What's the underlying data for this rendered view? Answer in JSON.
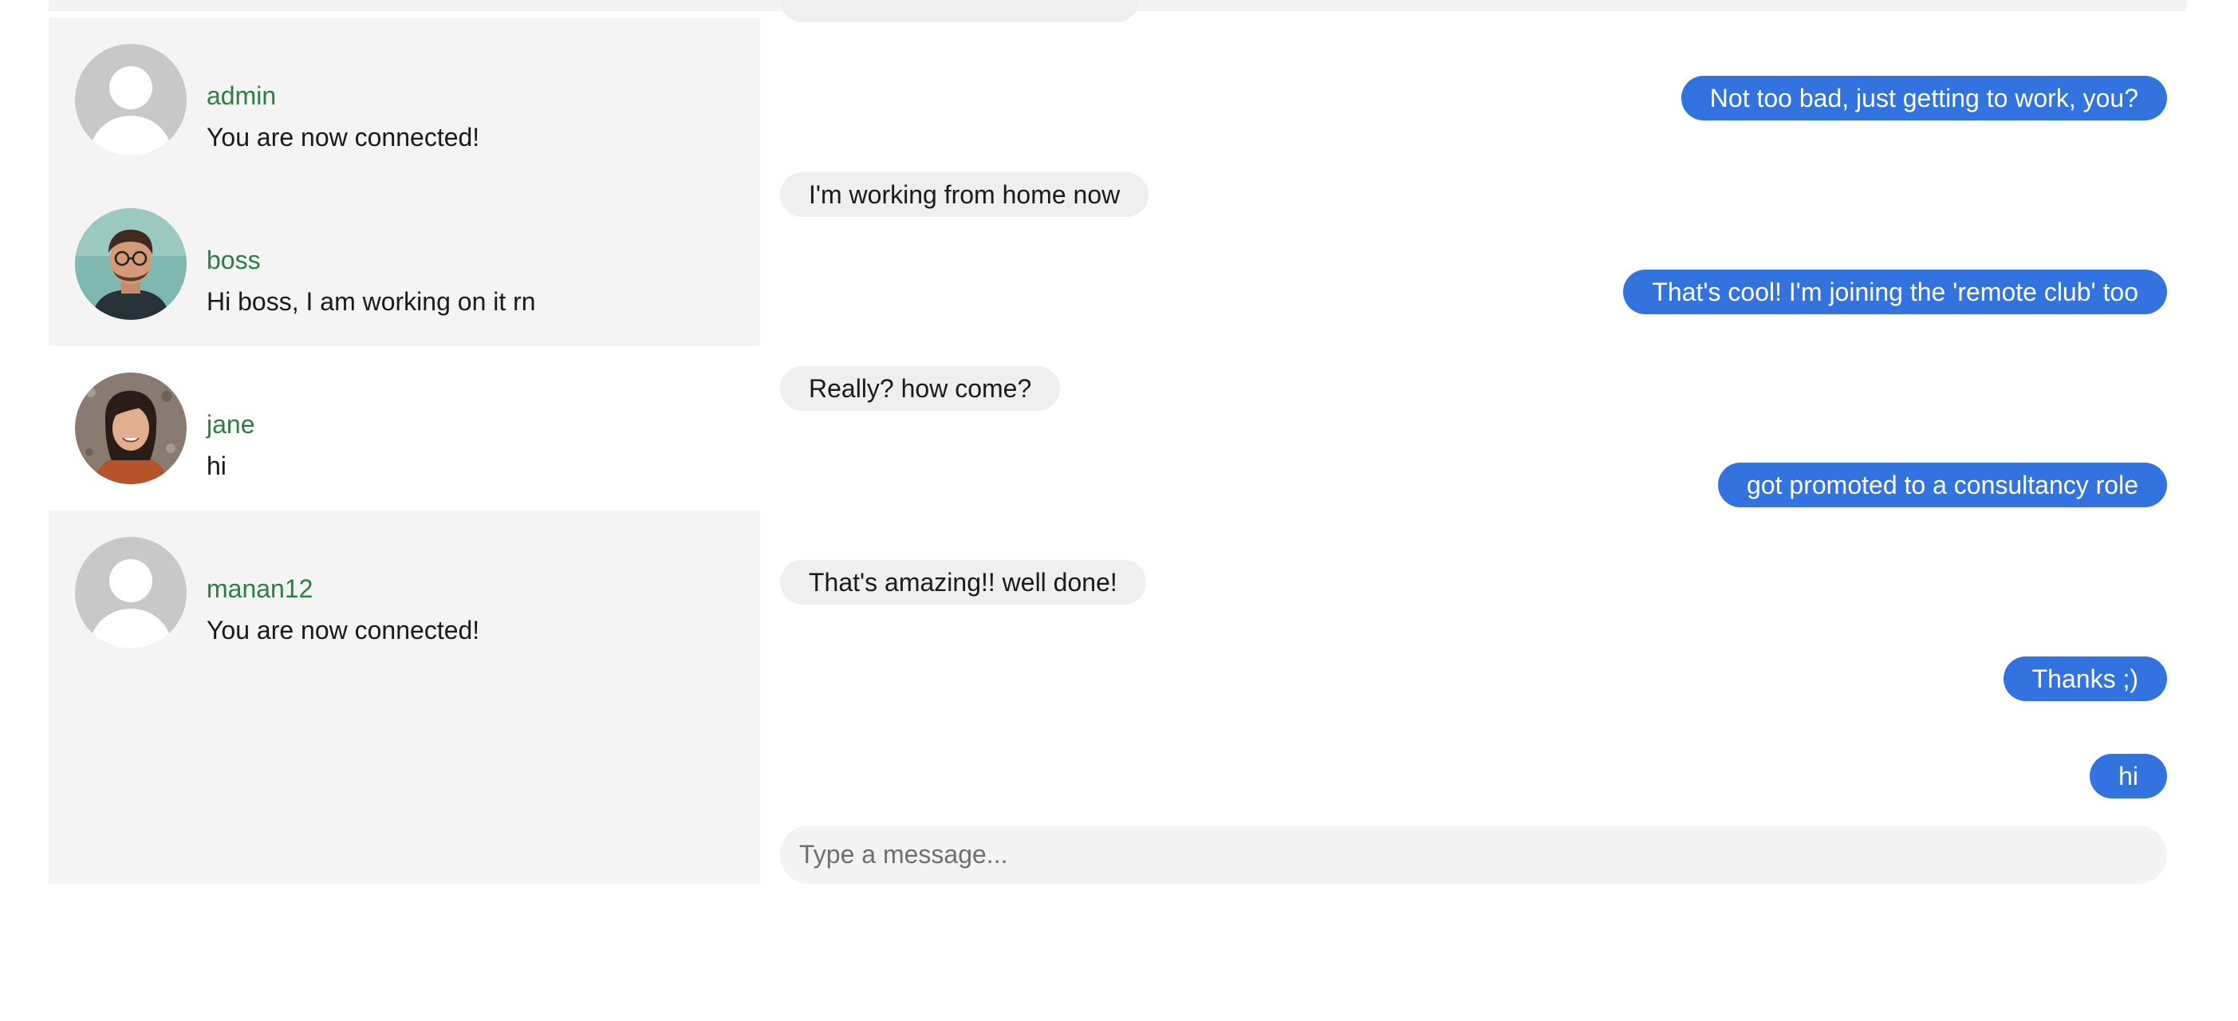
{
  "contacts": [
    {
      "name": "admin",
      "last_message": "You are now connected!",
      "avatar": "default-avatar-icon",
      "selected": false
    },
    {
      "name": "boss",
      "last_message": "Hi boss, I am working on it rn",
      "avatar": "photo-avatar",
      "selected": false
    },
    {
      "name": "jane",
      "last_message": "hi",
      "avatar": "photo-avatar",
      "selected": true
    },
    {
      "name": "manan12",
      "last_message": "You are now connected!",
      "avatar": "default-avatar-icon",
      "selected": false
    }
  ],
  "messages": [
    {
      "direction": "out",
      "text": "Not too bad, just getting to work, you?"
    },
    {
      "direction": "in",
      "text": "I'm working from home now"
    },
    {
      "direction": "out",
      "text": "That's cool! I'm joining the 'remote club' too"
    },
    {
      "direction": "in",
      "text": "Really? how come?"
    },
    {
      "direction": "out",
      "text": "got promoted to a consultancy role"
    },
    {
      "direction": "in",
      "text": "That's amazing!! well done!"
    },
    {
      "direction": "out",
      "text": "Thanks ;)"
    },
    {
      "direction": "out",
      "text": "hi"
    }
  ],
  "composer": {
    "placeholder": "Type a message..."
  },
  "colors": {
    "outgoing_bubble": "#3273e0",
    "incoming_bubble": "#efefef",
    "contact_name": "#2e7d42",
    "sidebar_bg": "#f4f4f4"
  }
}
